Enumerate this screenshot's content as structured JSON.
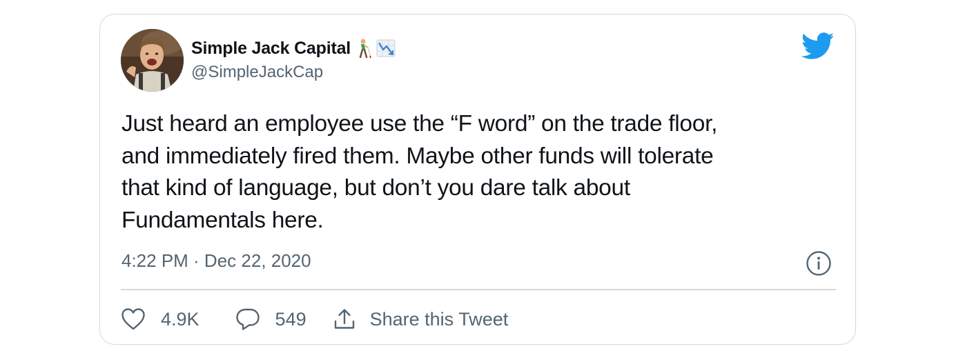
{
  "tweet": {
    "author": {
      "display_name": "Simple Jack Capital",
      "handle": "@SimpleJackCap",
      "name_emojis": [
        "person-with-white-cane-emoji",
        "chart-decreasing-emoji"
      ]
    },
    "text_lines": [
      "Just heard an employee use the “F word” on the trade floor,",
      "and immediately fired them. Maybe other funds will tolerate",
      "that kind of language, but don’t you dare talk about",
      "Fundamentals here."
    ],
    "timestamp": "4:22 PM · Dec 22, 2020",
    "actions": {
      "likes": "4.9K",
      "replies": "549",
      "share_label": "Share this Tweet"
    }
  },
  "colors": {
    "brand_blue": "#1d9bf0",
    "text_primary": "#0f1419",
    "text_secondary": "#536471",
    "border": "#cfd9de"
  }
}
